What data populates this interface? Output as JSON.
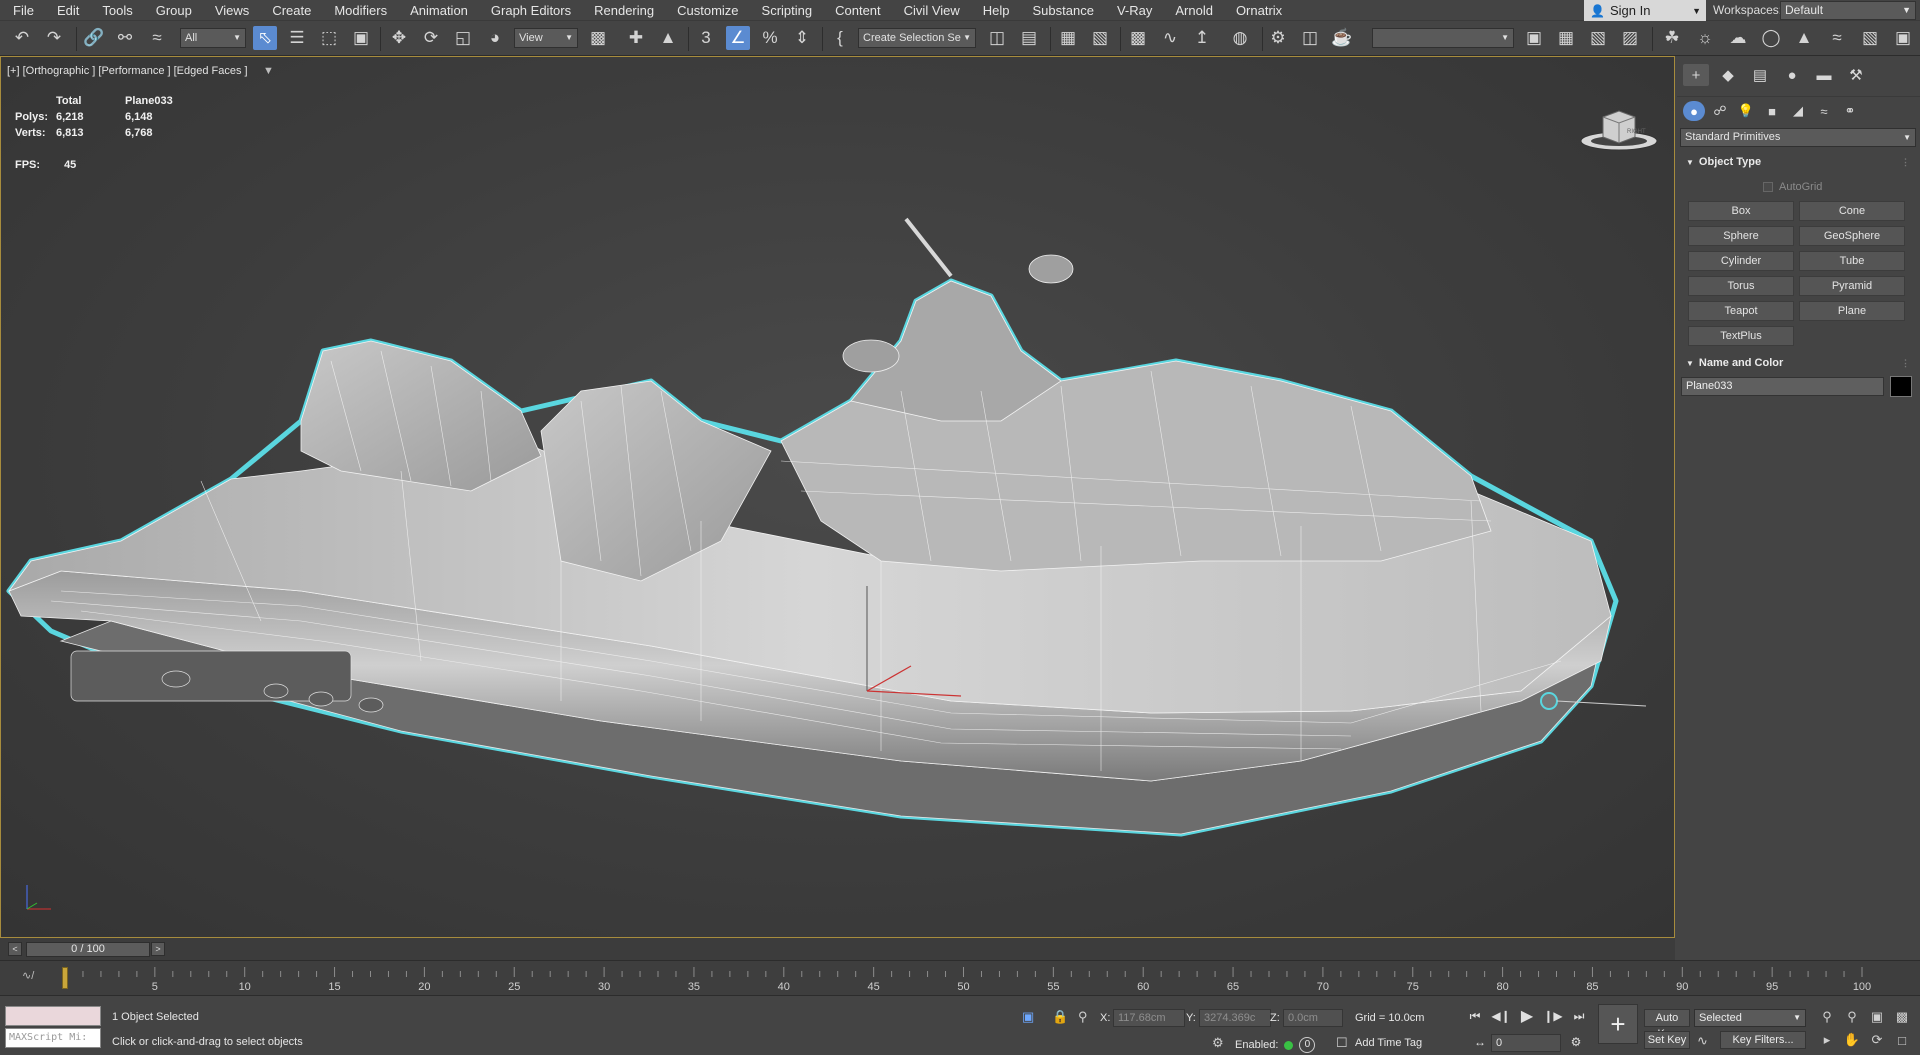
{
  "menu": [
    "File",
    "Edit",
    "Tools",
    "Group",
    "Views",
    "Create",
    "Modifiers",
    "Animation",
    "Graph Editors",
    "Rendering",
    "Customize",
    "Scripting",
    "Content",
    "Civil View",
    "Help",
    "Substance",
    "V-Ray",
    "Arnold",
    "Ornatrix"
  ],
  "account": {
    "sign_in": "Sign In",
    "workspaces_label": "Workspaces:",
    "workspace": "Default"
  },
  "toolbar": {
    "filter": "All",
    "ref_coord": "View",
    "selection_set": "Create Selection Se",
    "icons": [
      "undo-icon",
      "redo-icon",
      "link-icon",
      "unlink-icon",
      "bind-space-warp-icon",
      "select-object-icon",
      "select-by-name-icon",
      "rect-selection-icon",
      "window-crossing-icon",
      "move-icon",
      "rotate-icon",
      "scale-icon",
      "place-icon",
      "pivot-icon",
      "snap-icon",
      "angle-snap-icon",
      "percent-snap-icon",
      "spinner-snap-icon",
      "edit-named-sets-icon",
      "mirror-icon",
      "align-icon",
      "layer-explorer-icon",
      "scene-explorer-icon",
      "ribbon-icon",
      "curve-editor-icon",
      "schematic-icon",
      "material-editor-icon",
      "render-setup-icon",
      "rendered-frame-icon",
      "render-icon"
    ]
  },
  "viewport": {
    "label": "[+] [Orthographic ] [Performance ] [Edged Faces ]",
    "stats": {
      "headers": [
        "",
        "Total",
        "Plane033"
      ],
      "rows": [
        [
          "Polys:",
          "6,218",
          "6,148"
        ],
        [
          "Verts:",
          "6,813",
          "6,768"
        ]
      ]
    },
    "fps_label": "FPS:",
    "fps_value": "45",
    "viewcube_label": "RIGHT",
    "model_outline_color": "#5ad6df",
    "border_color": "#a78c3d"
  },
  "command_panel": {
    "tab_icons": [
      "create-tab-icon",
      "modify-tab-icon",
      "hierarchy-tab-icon",
      "motion-tab-icon",
      "display-tab-icon",
      "utilities-tab-icon"
    ],
    "category_icons": [
      "geometry-icon",
      "shapes-icon",
      "lights-icon",
      "cameras-icon",
      "helpers-icon",
      "space-warps-icon",
      "systems-icon"
    ],
    "category_dropdown": "Standard Primitives",
    "object_type_title": "Object Type",
    "autogrid_label": "AutoGrid",
    "primitives": [
      "Box",
      "Cone",
      "Sphere",
      "GeoSphere",
      "Cylinder",
      "Tube",
      "Torus",
      "Pyramid",
      "Teapot",
      "Plane",
      "TextPlus"
    ],
    "name_color_title": "Name and Color",
    "object_name": "Plane033",
    "object_color": "#000000"
  },
  "timeline": {
    "frame_display": "0 / 100",
    "prev": "<",
    "next": ">",
    "ticks": [
      "5",
      "10",
      "15",
      "20",
      "25",
      "30",
      "35",
      "40",
      "45",
      "50",
      "55",
      "60",
      "65",
      "70",
      "75",
      "80",
      "85",
      "90",
      "95",
      "100"
    ]
  },
  "status": {
    "maxscript_placeholder": "MAXScript Mi:",
    "selection": "1 Object Selected",
    "prompt": "Click or click-and-drag to select objects",
    "x_label": "X:",
    "x_value": "117.68cm",
    "y_label": "Y:",
    "y_value": "3274.369c",
    "z_label": "Z:",
    "z_value": "0.0cm",
    "grid": "Grid = 10.0cm",
    "enabled_label": "Enabled:",
    "enabled_count": "0",
    "add_time_tag": "Add Time Tag",
    "current_frame": "0",
    "auto_key": "Auto Key",
    "set_key": "Set Key",
    "key_target": "Selected",
    "key_filters": "Key Filters..."
  }
}
